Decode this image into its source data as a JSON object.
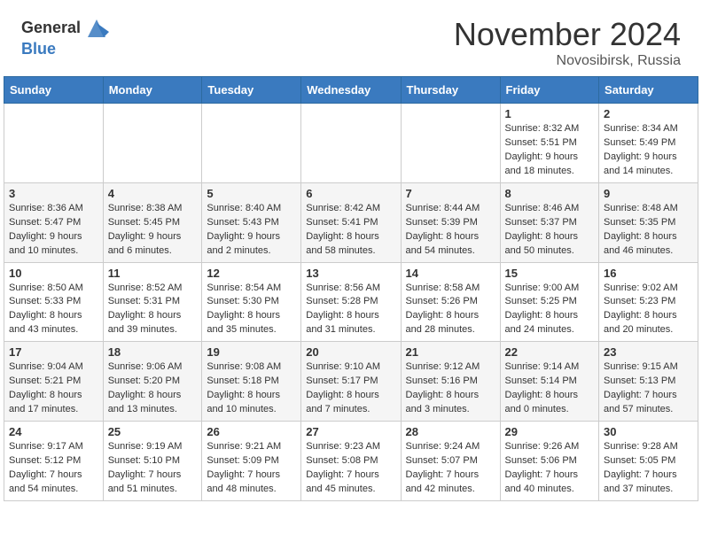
{
  "header": {
    "logo_general": "General",
    "logo_blue": "Blue",
    "month_title": "November 2024",
    "location": "Novosibirsk, Russia"
  },
  "weekdays": [
    "Sunday",
    "Monday",
    "Tuesday",
    "Wednesday",
    "Thursday",
    "Friday",
    "Saturday"
  ],
  "weeks": [
    [
      {
        "day": "",
        "info": ""
      },
      {
        "day": "",
        "info": ""
      },
      {
        "day": "",
        "info": ""
      },
      {
        "day": "",
        "info": ""
      },
      {
        "day": "",
        "info": ""
      },
      {
        "day": "1",
        "info": "Sunrise: 8:32 AM\nSunset: 5:51 PM\nDaylight: 9 hours\nand 18 minutes."
      },
      {
        "day": "2",
        "info": "Sunrise: 8:34 AM\nSunset: 5:49 PM\nDaylight: 9 hours\nand 14 minutes."
      }
    ],
    [
      {
        "day": "3",
        "info": "Sunrise: 8:36 AM\nSunset: 5:47 PM\nDaylight: 9 hours\nand 10 minutes."
      },
      {
        "day": "4",
        "info": "Sunrise: 8:38 AM\nSunset: 5:45 PM\nDaylight: 9 hours\nand 6 minutes."
      },
      {
        "day": "5",
        "info": "Sunrise: 8:40 AM\nSunset: 5:43 PM\nDaylight: 9 hours\nand 2 minutes."
      },
      {
        "day": "6",
        "info": "Sunrise: 8:42 AM\nSunset: 5:41 PM\nDaylight: 8 hours\nand 58 minutes."
      },
      {
        "day": "7",
        "info": "Sunrise: 8:44 AM\nSunset: 5:39 PM\nDaylight: 8 hours\nand 54 minutes."
      },
      {
        "day": "8",
        "info": "Sunrise: 8:46 AM\nSunset: 5:37 PM\nDaylight: 8 hours\nand 50 minutes."
      },
      {
        "day": "9",
        "info": "Sunrise: 8:48 AM\nSunset: 5:35 PM\nDaylight: 8 hours\nand 46 minutes."
      }
    ],
    [
      {
        "day": "10",
        "info": "Sunrise: 8:50 AM\nSunset: 5:33 PM\nDaylight: 8 hours\nand 43 minutes."
      },
      {
        "day": "11",
        "info": "Sunrise: 8:52 AM\nSunset: 5:31 PM\nDaylight: 8 hours\nand 39 minutes."
      },
      {
        "day": "12",
        "info": "Sunrise: 8:54 AM\nSunset: 5:30 PM\nDaylight: 8 hours\nand 35 minutes."
      },
      {
        "day": "13",
        "info": "Sunrise: 8:56 AM\nSunset: 5:28 PM\nDaylight: 8 hours\nand 31 minutes."
      },
      {
        "day": "14",
        "info": "Sunrise: 8:58 AM\nSunset: 5:26 PM\nDaylight: 8 hours\nand 28 minutes."
      },
      {
        "day": "15",
        "info": "Sunrise: 9:00 AM\nSunset: 5:25 PM\nDaylight: 8 hours\nand 24 minutes."
      },
      {
        "day": "16",
        "info": "Sunrise: 9:02 AM\nSunset: 5:23 PM\nDaylight: 8 hours\nand 20 minutes."
      }
    ],
    [
      {
        "day": "17",
        "info": "Sunrise: 9:04 AM\nSunset: 5:21 PM\nDaylight: 8 hours\nand 17 minutes."
      },
      {
        "day": "18",
        "info": "Sunrise: 9:06 AM\nSunset: 5:20 PM\nDaylight: 8 hours\nand 13 minutes."
      },
      {
        "day": "19",
        "info": "Sunrise: 9:08 AM\nSunset: 5:18 PM\nDaylight: 8 hours\nand 10 minutes."
      },
      {
        "day": "20",
        "info": "Sunrise: 9:10 AM\nSunset: 5:17 PM\nDaylight: 8 hours\nand 7 minutes."
      },
      {
        "day": "21",
        "info": "Sunrise: 9:12 AM\nSunset: 5:16 PM\nDaylight: 8 hours\nand 3 minutes."
      },
      {
        "day": "22",
        "info": "Sunrise: 9:14 AM\nSunset: 5:14 PM\nDaylight: 8 hours\nand 0 minutes."
      },
      {
        "day": "23",
        "info": "Sunrise: 9:15 AM\nSunset: 5:13 PM\nDaylight: 7 hours\nand 57 minutes."
      }
    ],
    [
      {
        "day": "24",
        "info": "Sunrise: 9:17 AM\nSunset: 5:12 PM\nDaylight: 7 hours\nand 54 minutes."
      },
      {
        "day": "25",
        "info": "Sunrise: 9:19 AM\nSunset: 5:10 PM\nDaylight: 7 hours\nand 51 minutes."
      },
      {
        "day": "26",
        "info": "Sunrise: 9:21 AM\nSunset: 5:09 PM\nDaylight: 7 hours\nand 48 minutes."
      },
      {
        "day": "27",
        "info": "Sunrise: 9:23 AM\nSunset: 5:08 PM\nDaylight: 7 hours\nand 45 minutes."
      },
      {
        "day": "28",
        "info": "Sunrise: 9:24 AM\nSunset: 5:07 PM\nDaylight: 7 hours\nand 42 minutes."
      },
      {
        "day": "29",
        "info": "Sunrise: 9:26 AM\nSunset: 5:06 PM\nDaylight: 7 hours\nand 40 minutes."
      },
      {
        "day": "30",
        "info": "Sunrise: 9:28 AM\nSunset: 5:05 PM\nDaylight: 7 hours\nand 37 minutes."
      }
    ]
  ]
}
